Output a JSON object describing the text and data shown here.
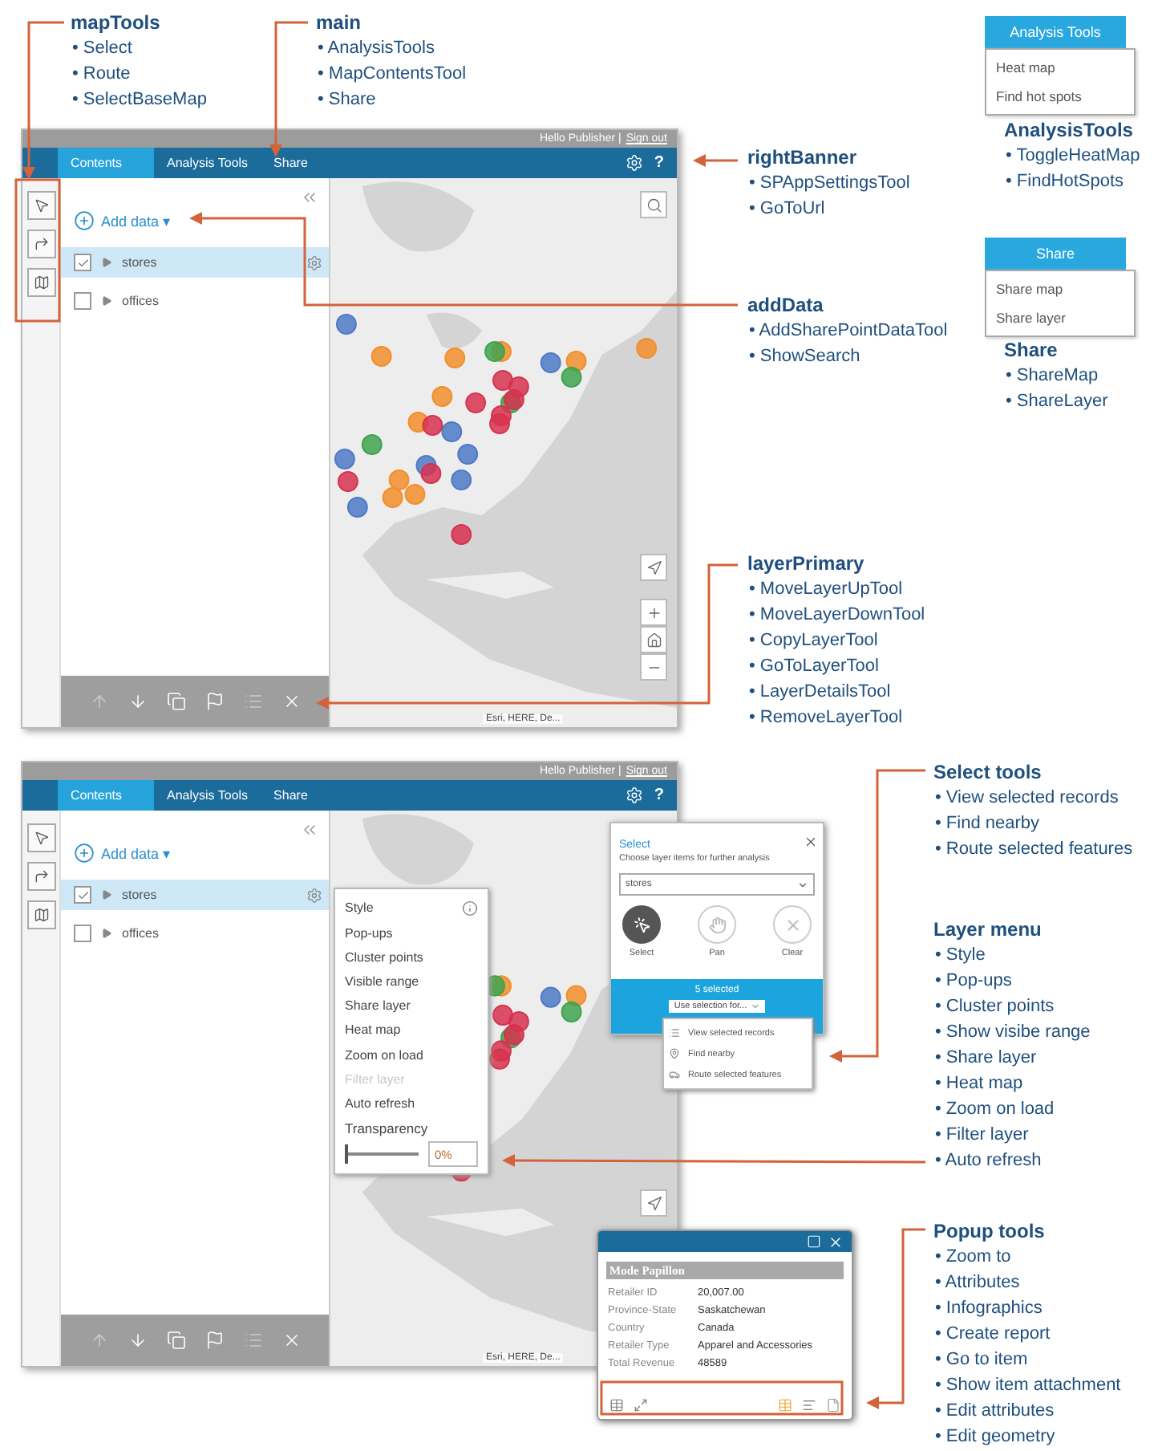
{
  "callouts": [
    {
      "title": "mapTools",
      "items": [
        "• Select",
        "• Route",
        "• SelectBaseMap"
      ]
    },
    {
      "title": "main",
      "items": [
        "• AnalysisTools",
        "• MapContentsTool",
        "• Share"
      ]
    },
    {
      "title": "rightBanner",
      "items": [
        "• SPAppSettingsTool",
        "• GoToUrl"
      ]
    },
    {
      "title": "addData",
      "items": [
        "• AddSharePointDataTool",
        "• ShowSearch"
      ]
    },
    {
      "title": "layerPrimary",
      "items": [
        "• MoveLayerUpTool",
        "• MoveLayerDownTool",
        "• CopyLayerTool",
        "• GoToLayerTool",
        "• LayerDetailsTool",
        "• RemoveLayerTool"
      ]
    },
    {
      "title": "AnalysisTools",
      "items": [
        "• ToggleHeatMap",
        "• FindHotSpots"
      ]
    },
    {
      "title": "Share",
      "items": [
        "• ShareMap",
        "• ShareLayer"
      ]
    },
    {
      "title": "Select tools",
      "items": [
        "• View selected records",
        "• Find nearby",
        "• Route selected features"
      ]
    },
    {
      "title": "Layer menu",
      "items": [
        "• Style",
        "• Pop-ups",
        "• Cluster points",
        "• Show visibe range",
        "• Share layer",
        "• Heat map",
        "• Zoom on load",
        "• Filter layer",
        "• Auto refresh"
      ]
    },
    {
      "title": "Popup tools",
      "items": [
        "• Zoom to",
        "• Attributes",
        "• Infographics",
        "• Create report",
        "• Go to item",
        "• Show item attachment",
        "• Edit attributes",
        "• Edit geometry"
      ]
    }
  ],
  "menus": [
    {
      "header": "Analysis Tools",
      "items": [
        "Heat map",
        "Find hot spots"
      ]
    },
    {
      "header": "Share",
      "items": [
        "Share map",
        "Share layer"
      ]
    }
  ],
  "apps": [
    {
      "greeting": "Hello Publisher |",
      "sign_out": "Sign out",
      "help": "?",
      "tabs": [
        {
          "label": "Contents",
          "selected": true
        },
        {
          "label": "Analysis Tools",
          "selected": false
        },
        {
          "label": "Share",
          "selected": false
        }
      ],
      "add_data": "Add data",
      "add_caret": "▾",
      "layers": [
        {
          "name": "stores",
          "checked": true,
          "selected": true
        },
        {
          "name": "offices",
          "checked": false,
          "selected": false
        }
      ],
      "attribution": "Esri, HERE, De..."
    },
    {
      "greeting": "Hello Publisher |",
      "sign_out": "Sign out",
      "help": "?",
      "tabs": [
        {
          "label": "Contents",
          "selected": true
        },
        {
          "label": "Analysis Tools",
          "selected": false
        },
        {
          "label": "Share",
          "selected": false
        }
      ],
      "add_data": "Add data",
      "add_caret": "▾",
      "layers": [
        {
          "name": "stores",
          "checked": true,
          "selected": true
        },
        {
          "name": "offices",
          "checked": false,
          "selected": false
        }
      ],
      "attribution": "Esri, HERE, De..."
    }
  ],
  "layer_menu": {
    "items": [
      {
        "label": "Style",
        "disabled": false
      },
      {
        "label": "Pop-ups",
        "disabled": false
      },
      {
        "label": "Cluster points",
        "disabled": false
      },
      {
        "label": "Visible range",
        "disabled": false
      },
      {
        "label": "Share layer",
        "disabled": false
      },
      {
        "label": "Heat map",
        "disabled": false
      },
      {
        "label": "Zoom on load",
        "disabled": false
      },
      {
        "label": "Filter layer",
        "disabled": true
      },
      {
        "label": "Auto refresh",
        "disabled": false
      }
    ],
    "transparency_label": "Transparency",
    "transparency": {
      "level": 0,
      "value": "0%"
    }
  },
  "select_panel": {
    "title": "Select",
    "subtitle": "Choose layer items for further analysis",
    "layer": "stores",
    "tools": [
      {
        "label": "Select",
        "selected": true
      },
      {
        "label": "Pan",
        "selected": false
      },
      {
        "label": "Clear",
        "selected": false
      }
    ],
    "status": "5 selected",
    "use_selection": "Use selection for...",
    "options": [
      "View selected records",
      "Find nearby",
      "Route selected features"
    ]
  },
  "popup": {
    "title": "Mode Papillon",
    "fields": [
      {
        "label": "Retailer ID",
        "value": "20,007.00"
      },
      {
        "label": "Province-State",
        "value": "Saskatchewan"
      },
      {
        "label": "Country",
        "value": "Canada"
      },
      {
        "label": "Retailer Type",
        "value": "Apparel and Accessories"
      },
      {
        "label": "Total Revenue",
        "value": "48589"
      }
    ]
  }
}
